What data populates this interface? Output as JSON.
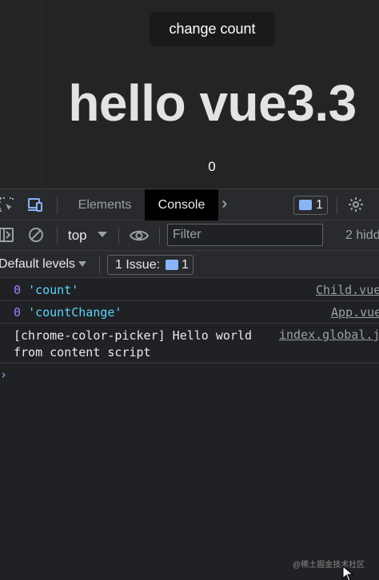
{
  "page": {
    "change_button_label": "change count",
    "heading": "hello vue3.3",
    "count_value": "0"
  },
  "devtools": {
    "tabs": [
      {
        "label": "Elements",
        "active": false
      },
      {
        "label": "Console",
        "active": true
      }
    ],
    "issues_badge_count": "1",
    "context_selector": "top",
    "filter_placeholder": "Filter",
    "hidden_count_text": "2 hidd",
    "levels_label": "Default levels",
    "issue_button": {
      "label": "1 Issue:",
      "count": "1"
    }
  },
  "console": {
    "rows": [
      {
        "number": "0",
        "string": "'count'",
        "source": "Child.vue"
      },
      {
        "number": "0",
        "string": "'countChange'",
        "source": "App.vue"
      },
      {
        "message": "[chrome-color-picker] Hello world\nfrom content script",
        "source": "index.global.j"
      }
    ],
    "prompt": "›"
  },
  "watermark": "@稀土掘金技术社区",
  "colors": {
    "page_bg": "#242424",
    "devtools_bg": "#202124",
    "toolbar_bg": "#292a2d",
    "string_color": "#5cd5fb",
    "number_color": "#9980ff",
    "accent_blue": "#8ab4f8"
  }
}
